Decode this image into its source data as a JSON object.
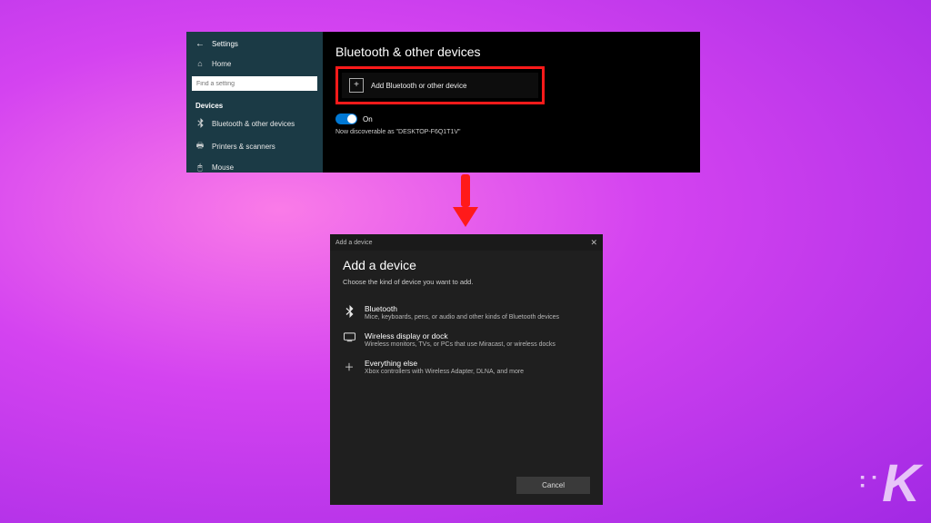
{
  "settings": {
    "header": "Settings",
    "back": "←",
    "home_label": "Home",
    "search_placeholder": "Find a setting",
    "section_label": "Devices",
    "nav": [
      {
        "icon": "bt",
        "label": "Bluetooth & other devices"
      },
      {
        "icon": "printer",
        "label": "Printers & scanners"
      },
      {
        "icon": "mouse",
        "label": "Mouse"
      }
    ],
    "page_title": "Bluetooth & other devices",
    "add_btn": "Add Bluetooth or other device",
    "toggle_state": "On",
    "discoverable": "Now discoverable as \"DESKTOP-F6Q1T1V\""
  },
  "dialog": {
    "titlebar": "Add a device",
    "heading": "Add a device",
    "subtitle": "Choose the kind of device you want to add.",
    "options": [
      {
        "title": "Bluetooth",
        "desc": "Mice, keyboards, pens, or audio and other kinds of Bluetooth devices"
      },
      {
        "title": "Wireless display or dock",
        "desc": "Wireless monitors, TVs, or PCs that use Miracast, or wireless docks"
      },
      {
        "title": "Everything else",
        "desc": "Xbox controllers with Wireless Adapter, DLNA, and more"
      }
    ],
    "cancel": "Cancel"
  },
  "watermark": "K"
}
